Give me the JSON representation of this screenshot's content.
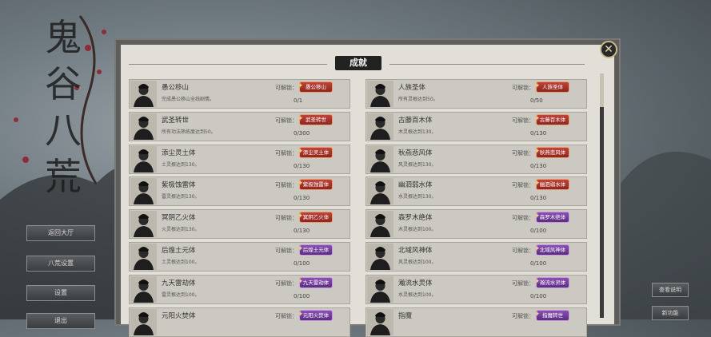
{
  "game": {
    "logo_text": "鬼谷八荒"
  },
  "left_menu": [
    {
      "label": "返回大厅"
    },
    {
      "label": "八荒设置"
    },
    {
      "label": "设置"
    },
    {
      "label": "退出"
    }
  ],
  "right_menu": [
    {
      "label": "查看说明"
    },
    {
      "label": "新功能"
    }
  ],
  "panel": {
    "title": "成就",
    "unlock_label": "可解锁："
  },
  "achievements": [
    {
      "name": "愚公移山",
      "desc": "完成愚公移山全线剧情。",
      "reward": "愚公移山",
      "reward_color": "red",
      "progress": "0/1"
    },
    {
      "name": "人族圣体",
      "desc": "所有灵根达到50。",
      "reward": "人族圣体",
      "reward_color": "red",
      "progress": "0/50"
    },
    {
      "name": "武圣转世",
      "desc": "所有功法熟练度达到50。",
      "reward": "武圣转世",
      "reward_color": "red",
      "progress": "0/300"
    },
    {
      "name": "古藤百木体",
      "desc": "木灵根达到130。",
      "reward": "古藤百木体",
      "reward_color": "red",
      "progress": "0/130"
    },
    {
      "name": "添尘灵土体",
      "desc": "土灵根达到130。",
      "reward": "添尘灵土体",
      "reward_color": "red",
      "progress": "0/130"
    },
    {
      "name": "秋燕悲风体",
      "desc": "风灵根达到130。",
      "reward": "秋燕悲风体",
      "reward_color": "red",
      "progress": "0/130"
    },
    {
      "name": "紫极蚀雷体",
      "desc": "雷灵根达到130。",
      "reward": "紫极蚀雷体",
      "reward_color": "red",
      "progress": "0/130"
    },
    {
      "name": "幽泗弱水体",
      "desc": "水灵根达到130。",
      "reward": "幽泗弱水体",
      "reward_color": "red",
      "progress": "0/130"
    },
    {
      "name": "冥阴乙火体",
      "desc": "火灵根达到130。",
      "reward": "冥阴乙火体",
      "reward_color": "red",
      "progress": "0/130"
    },
    {
      "name": "森罗木绝体",
      "desc": "木灵根达到100。",
      "reward": "森罗木绝体",
      "reward_color": "purple",
      "progress": "0/100"
    },
    {
      "name": "后煌土元体",
      "desc": "土灵根达到100。",
      "reward": "后煌土元体",
      "reward_color": "purple",
      "progress": "0/100"
    },
    {
      "name": "北域风神体",
      "desc": "风灵根达到100。",
      "reward": "北域风神体",
      "reward_color": "purple",
      "progress": "0/100"
    },
    {
      "name": "九天雷劫体",
      "desc": "雷灵根达到100。",
      "reward": "九天雷劫体",
      "reward_color": "purple",
      "progress": "0/100"
    },
    {
      "name": "瀚流水灵体",
      "desc": "水灵根达到100。",
      "reward": "瀚流水灵体",
      "reward_color": "purple",
      "progress": "0/100"
    },
    {
      "name": "元阳火焚体",
      "desc": "",
      "reward": "元阳火焚体",
      "reward_color": "purple",
      "progress": ""
    },
    {
      "name": "指魔",
      "desc": "",
      "reward": "指魔转世",
      "reward_color": "purple",
      "progress": ""
    }
  ],
  "colors": {
    "reward_red": "#a8322b",
    "reward_purple": "#72409c",
    "panel_bg": "#e2dfd8"
  }
}
